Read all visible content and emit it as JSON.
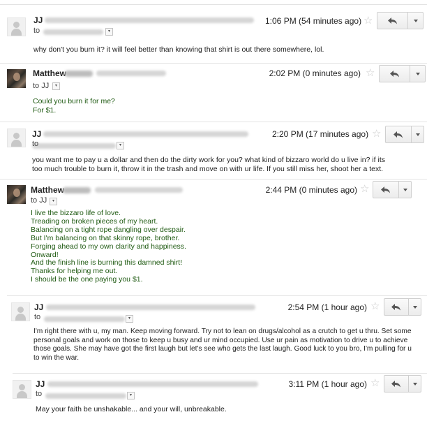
{
  "messages": [
    {
      "sender": "JJ",
      "to": "to",
      "time": "1:06 PM (54 minutes ago)",
      "body": [
        "why don't you burn it?  it will feel better than knowing that shirt is out there somewhere, lol."
      ]
    },
    {
      "sender": "Matthew",
      "to": "to JJ",
      "time": "2:02 PM (0 minutes ago)",
      "body": [
        "Could you burn it for me?",
        "For $1."
      ]
    },
    {
      "sender": "JJ",
      "to": "to",
      "time": "2:20 PM (17 minutes ago)",
      "body": [
        "you want me to pay u a dollar and then do the dirty work for you?  what kind of bizzaro world do u live in?  if its",
        "too much trouble to burn it, throw it in the trash and move on with ur life.  If you still miss her, shoot her a text."
      ]
    },
    {
      "sender": "Matthew",
      "to": "to JJ",
      "time": "2:44 PM (0 minutes ago)",
      "body": [
        "I live the bizzaro life of love.",
        "Treading on broken pieces of my heart.",
        "Balancing on a tight rope dangling over despair.",
        "But I'm balancing on that skinny rope, brother.",
        "Forging ahead to my own clarity and happiness.",
        "Onward!",
        "And the finish line is burning this damned shirt!",
        "Thanks for helping me out.",
        "I should be the one paying you $1."
      ]
    },
    {
      "sender": "JJ",
      "to": "to",
      "time": "2:54 PM (1 hour ago)",
      "body": [
        "I'm right there with u, my man.  Keep moving forward.  Try not to lean on drugs/alcohol as a crutch to get u thru.  Set some",
        "personal goals and work on those to keep u busy and ur mind occupied.  Use ur pain as motivation to drive u to achieve",
        "those goals.  She may have got the first laugh but let's see who gets the last laugh.  Good luck to you bro, I'm pulling for u",
        "to win the war."
      ]
    },
    {
      "sender": "JJ",
      "to": "to",
      "time": "3:11 PM (1 hour ago)",
      "body": [
        "May your faith be unshakable... and your will, unbreakable."
      ]
    }
  ],
  "icons": {
    "star": "star-icon",
    "reply": "reply-arrow-icon",
    "more": "chevron-down-icon",
    "avatar": "avatar-icon"
  },
  "colors": {
    "self_text": "#1f5a12",
    "other_text": "#222222"
  }
}
